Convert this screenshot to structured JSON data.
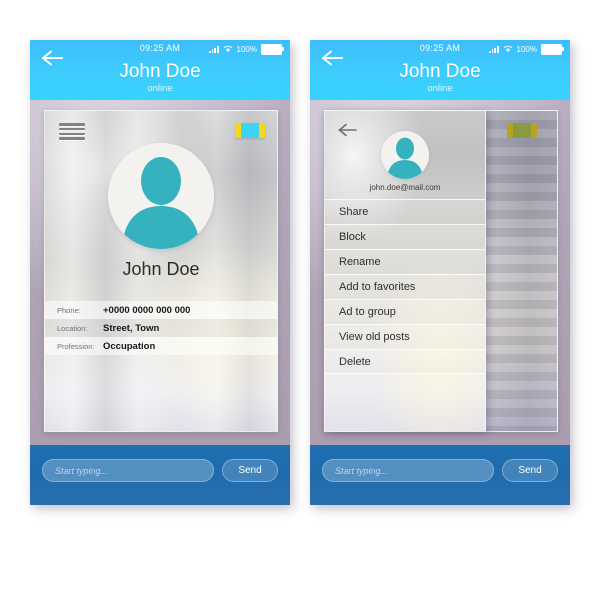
{
  "meta": {
    "background_color": "#ffffff",
    "header_color": "#3ecdfd",
    "compose_bar_color": "#1e6cad",
    "accent_teal": "#35b2bd",
    "frame_color": "#a99dae",
    "badge_yellow": "#f4d716",
    "badge_cyan": "#3fd2f7"
  },
  "statusbar": {
    "time": "09:25 AM",
    "battery_percent": "100%",
    "signal_icon": "signal-bars-icon",
    "wifi_icon": "wifi-icon",
    "battery_icon": "battery-full-icon",
    "back_icon": "back-arrow-icon"
  },
  "header": {
    "title": "John Doe",
    "status": "online"
  },
  "screen_profile": {
    "menu_icon": "hamburger-menu-icon",
    "badge_icon": "color-badge-icon",
    "avatar_icon": "user-avatar-icon",
    "profile_name": "John Doe",
    "info_rows": [
      {
        "label": "Phone:",
        "value": "+0000 0000 000 000"
      },
      {
        "label": "Location:",
        "value": "Street, Town"
      },
      {
        "label": "Profession:",
        "value": "Occupation"
      }
    ]
  },
  "screen_drawer": {
    "back_icon": "back-arrow-icon",
    "avatar_icon": "user-avatar-icon",
    "email": "john.doe@mail.com",
    "badge_icon": "color-badge-icon",
    "menu_items": [
      {
        "label": "Share"
      },
      {
        "label": "Block"
      },
      {
        "label": "Rename"
      },
      {
        "label": "Add to favorites"
      },
      {
        "label": "Ad to group"
      },
      {
        "label": "View old posts"
      },
      {
        "label": "Delete"
      }
    ]
  },
  "compose": {
    "placeholder": "Start typing...",
    "input_value": "",
    "send_label": "Send"
  }
}
